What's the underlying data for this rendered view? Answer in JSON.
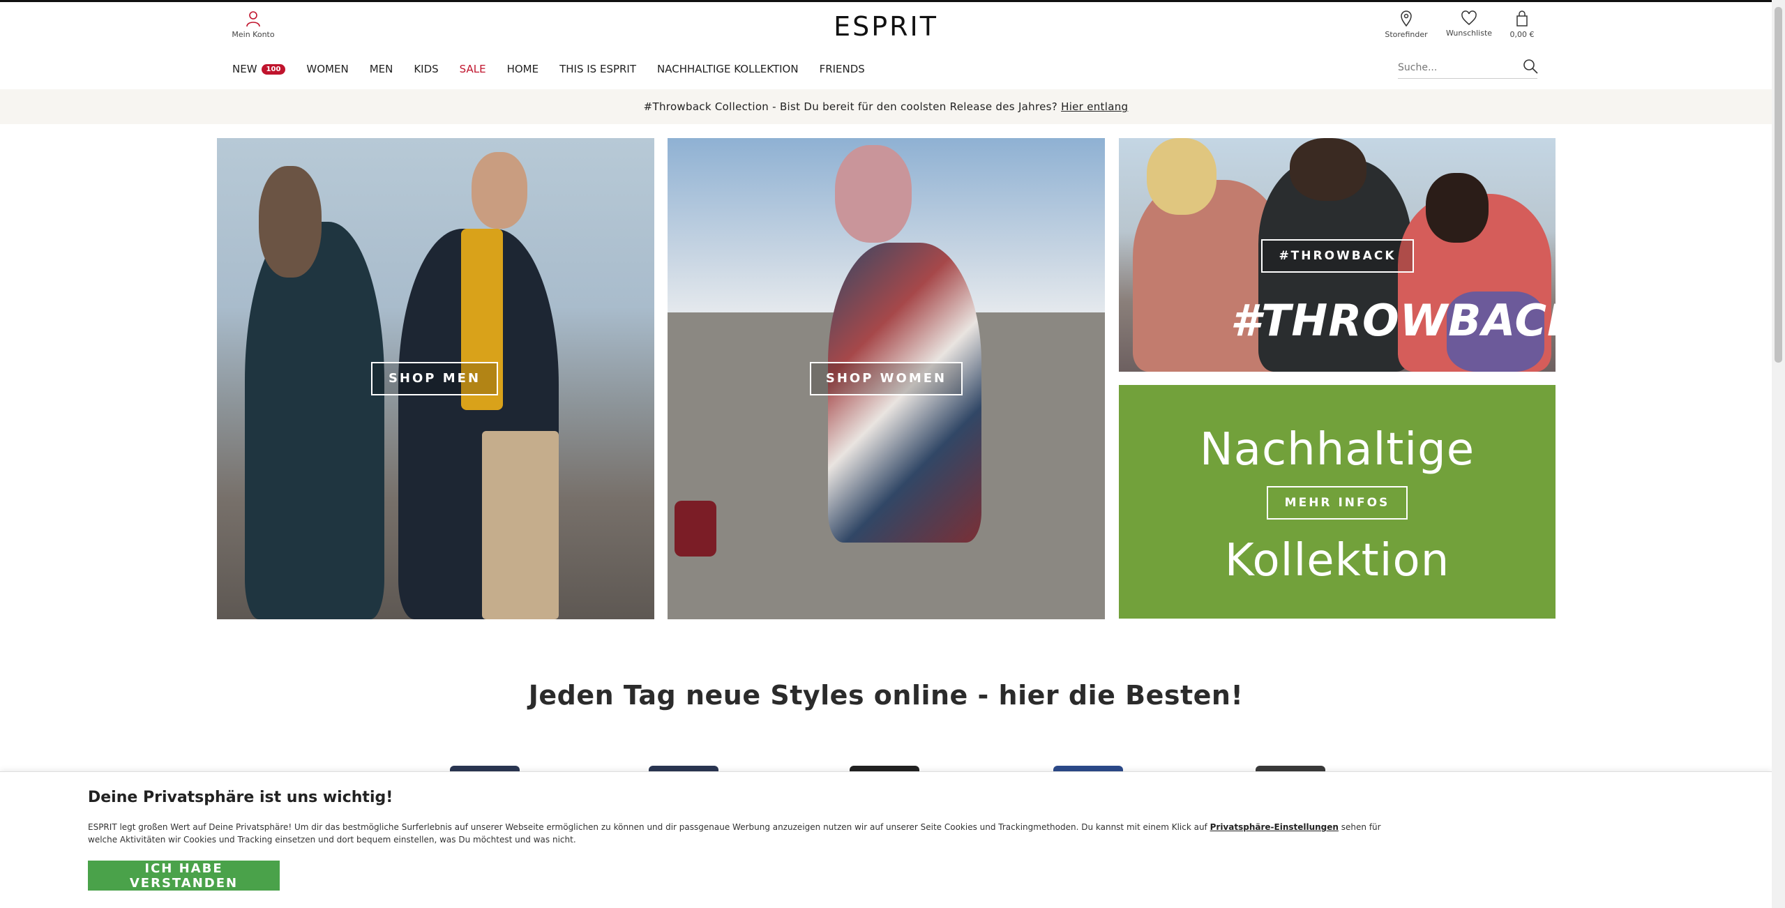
{
  "header": {
    "account_label": "Mein Konto",
    "logo": "ESPRIT",
    "storefinder_label": "Storefinder",
    "wishlist_label": "Wunschliste",
    "cart_label": "0,00 €"
  },
  "nav": {
    "items": [
      {
        "label": "NEW",
        "badge": "100"
      },
      {
        "label": "WOMEN"
      },
      {
        "label": "MEN"
      },
      {
        "label": "KIDS"
      },
      {
        "label": "SALE"
      },
      {
        "label": "HOME"
      },
      {
        "label": "THIS IS ESPRIT"
      },
      {
        "label": "NACHHALTIGE KOLLEKTION"
      },
      {
        "label": "FRIENDS"
      }
    ],
    "search_placeholder": "Suche..."
  },
  "promo": {
    "text": "#Throwback Collection - Bist Du bereit für den coolsten Release des Jahres?",
    "link": "Hier entlang"
  },
  "tiles": {
    "men_button": "SHOP MEN",
    "women_button": "SHOP WOMEN",
    "throwback_button": "#THROWBACK",
    "throwback_overlay": "#THROWBACK",
    "green_top": "Nachhaltige",
    "green_button": "MEHR INFOS",
    "green_bottom": "Kollektion"
  },
  "section": {
    "title": "Jeden Tag neue Styles online - hier die Besten!"
  },
  "cookie": {
    "title": "Deine Privatsphäre ist uns wichtig!",
    "text_before": "ESPRIT legt großen Wert auf Deine Privatsphäre! Um dir das bestmögliche Surferlebnis auf unserer Webseite ermöglichen zu können und dir passgenaue Werbung anzuzeigen nutzen wir auf unserer Seite Cookies und Trackingmethoden. Du kannst mit einem Klick auf ",
    "link": "Privatsphäre-Einstellungen",
    "text_after": " sehen für welche Aktivitäten wir Cookies und Tracking einsetzen und dort bequem einstellen, was Du möchtest und was nicht.",
    "button": "ICH HABE VERSTANDEN"
  },
  "colors": {
    "sale": "#c0142d",
    "promo_bg": "#f7f5f1",
    "sustainable_green": "#72a13b",
    "cookie_button": "#4aa24a"
  }
}
